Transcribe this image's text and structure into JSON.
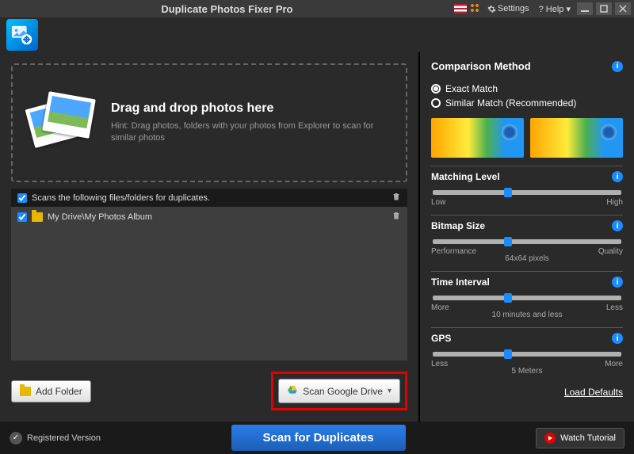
{
  "titlebar": {
    "title": "Duplicate Photos Fixer Pro",
    "settings": "Settings",
    "help": "Help"
  },
  "dropzone": {
    "heading": "Drag and drop photos here",
    "hint": "Hint: Drag photos, folders with your photos from Explorer to scan for similar photos"
  },
  "list": {
    "header": "Scans the following files/folders for duplicates.",
    "items": [
      "My Drive\\My Photos Album"
    ]
  },
  "buttons": {
    "add_folder": "Add Folder",
    "scan_gd": "Scan Google Drive",
    "scan_dup": "Scan for Duplicates",
    "tutorial": "Watch Tutorial"
  },
  "sidebar": {
    "comparison": "Comparison Method",
    "exact": "Exact Match",
    "similar": "Similar Match (Recommended)",
    "matching": {
      "title": "Matching Level",
      "low": "Low",
      "high": "High"
    },
    "bitmap": {
      "title": "Bitmap Size",
      "low": "Performance",
      "center": "64x64 pixels",
      "high": "Quality"
    },
    "time": {
      "title": "Time Interval",
      "low": "More",
      "center": "10 minutes and less",
      "high": "Less"
    },
    "gps": {
      "title": "GPS",
      "low": "Less",
      "center": "5 Meters",
      "high": "More"
    },
    "load_defaults": "Load Defaults"
  },
  "footer": {
    "registered": "Registered Version"
  }
}
